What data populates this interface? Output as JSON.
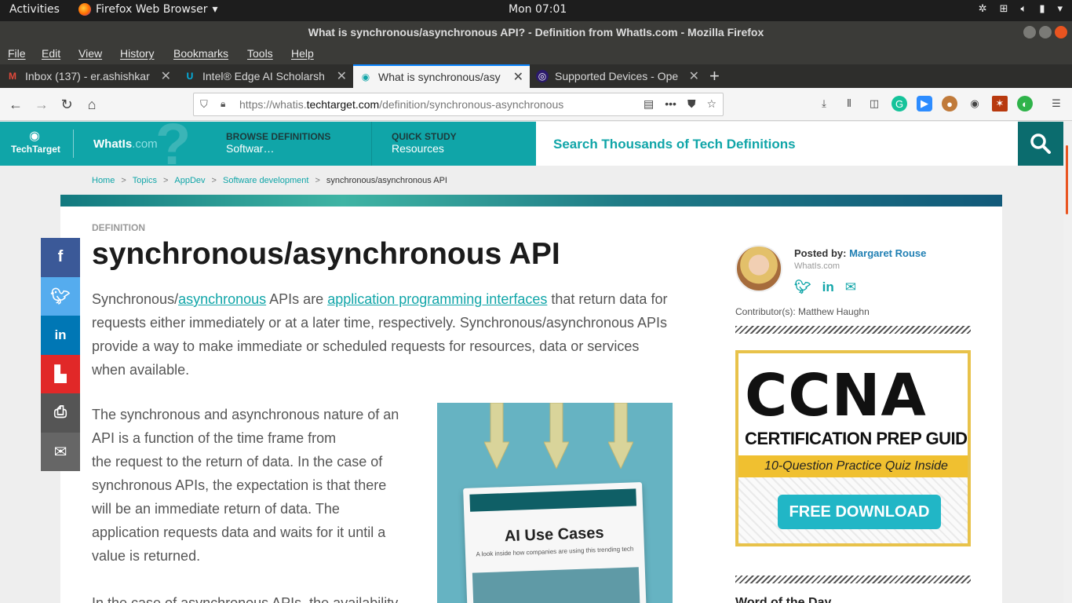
{
  "topbar": {
    "activities": "Activities",
    "app_name": "Firefox Web Browser",
    "clock": "Mon 07:01"
  },
  "window": {
    "title": "What is synchronous/asynchronous API? - Definition from WhatIs.com - Mozilla Firefox"
  },
  "menubar": {
    "items": [
      "File",
      "Edit",
      "View",
      "History",
      "Bookmarks",
      "Tools",
      "Help"
    ]
  },
  "tabs": [
    {
      "label": "Inbox (137) - er.ashishkar",
      "icon": "gmail-icon"
    },
    {
      "label": "Intel® Edge AI Scholarsh",
      "icon": "udacity-icon"
    },
    {
      "label": "What is synchronous/asy",
      "icon": "whatis-eye-icon"
    },
    {
      "label": "Supported Devices - Ope",
      "icon": "openvino-icon"
    }
  ],
  "urlbar": {
    "prefix": "https://whatis.",
    "domain": "techtarget.com",
    "path": "/definition/synchronous-asynchronous"
  },
  "site": {
    "brand": "TechTarget",
    "whatis": "WhatIs",
    "whatis_suffix": ".com",
    "browse_label": "BROWSE DEFINITIONS",
    "browse_value": "Softwar…",
    "quick_label": "QUICK STUDY",
    "quick_value": "Resources",
    "search_placeholder": "Search Thousands of Tech Definitions"
  },
  "breadcrumb": {
    "items": [
      "Home",
      "Topics",
      "AppDev",
      "Software development"
    ],
    "current": "synchronous/asynchronous API"
  },
  "article": {
    "label": "DEFINITION",
    "title": "synchronous/asynchronous API",
    "p1_a": "Synchronous/",
    "p1_link1": "asynchronous",
    "p1_b": " APIs are ",
    "p1_link2": "application programming interfaces",
    "p1_c": " that return data for requests either immediately or at a later time, respectively. Synchronous/asynchronous APIs provide a way to make immediate or scheduled requests for resources, data or services when available.",
    "p2_line1": "The synchronous and asynchronous nature of an",
    "p2_line2": "API is a function of the time frame from",
    "p2_rest": "the request to the return of data. In the case of synchronous APIs, the expectation is that there will be an immediate return of data. The application requests data and waits for it until a value is returned.",
    "p3": "In the case of asynchronous APIs, the availability"
  },
  "promo": {
    "book_title": "AI Use Cases",
    "book_subtitle": "A look inside how companies are using this trending tech"
  },
  "author": {
    "posted_by": "Posted by:",
    "name": "Margaret Rouse",
    "org": "WhatIs.com",
    "contributors": "Contributor(s): Matthew Haughn"
  },
  "ad": {
    "headline": "CCNA",
    "subhead": "CERTIFICATION PREP GUIDE",
    "strip": "10-Question Practice Quiz Inside",
    "cta": "FREE DOWNLOAD"
  },
  "sidebar": {
    "word_of_day": "Word of the Day"
  },
  "colors": {
    "brand_teal": "#10a5a8",
    "dark_teal": "#0b6c6e",
    "facebook": "#3b5998",
    "twitter": "#55acee",
    "linkedin": "#0077b5",
    "flipboard": "#e12828",
    "print": "#555555",
    "email": "#666666"
  }
}
